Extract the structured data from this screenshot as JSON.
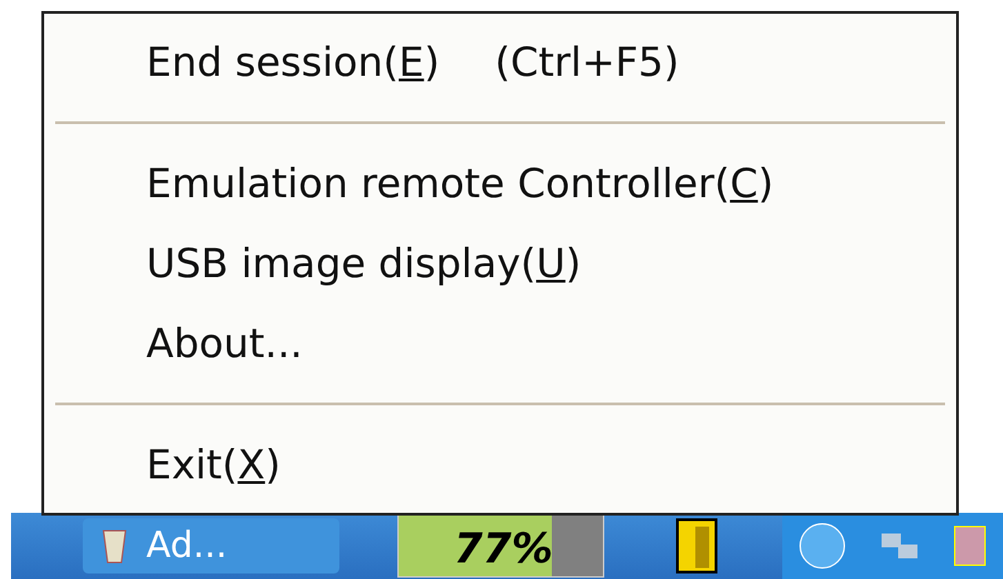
{
  "menu": {
    "items": [
      {
        "kind": "command",
        "label": "End session(",
        "mnemonic": "E",
        "label_end": ")",
        "shortcut": "(Ctrl+F5)"
      },
      {
        "kind": "separator"
      },
      {
        "kind": "command",
        "label": "Emulation remote Controller(",
        "mnemonic": "C",
        "label_end": ")"
      },
      {
        "kind": "command",
        "label": "USB image display(",
        "mnemonic": "U",
        "label_end": ")"
      },
      {
        "kind": "command",
        "label": "About..."
      },
      {
        "kind": "separator"
      },
      {
        "kind": "command",
        "label": "Exit(",
        "mnemonic": "X",
        "label_end": ")"
      }
    ]
  },
  "taskbar": {
    "task_button": {
      "label": "Ad..."
    },
    "meter": {
      "reading": "77%",
      "level": 0.75
    }
  }
}
